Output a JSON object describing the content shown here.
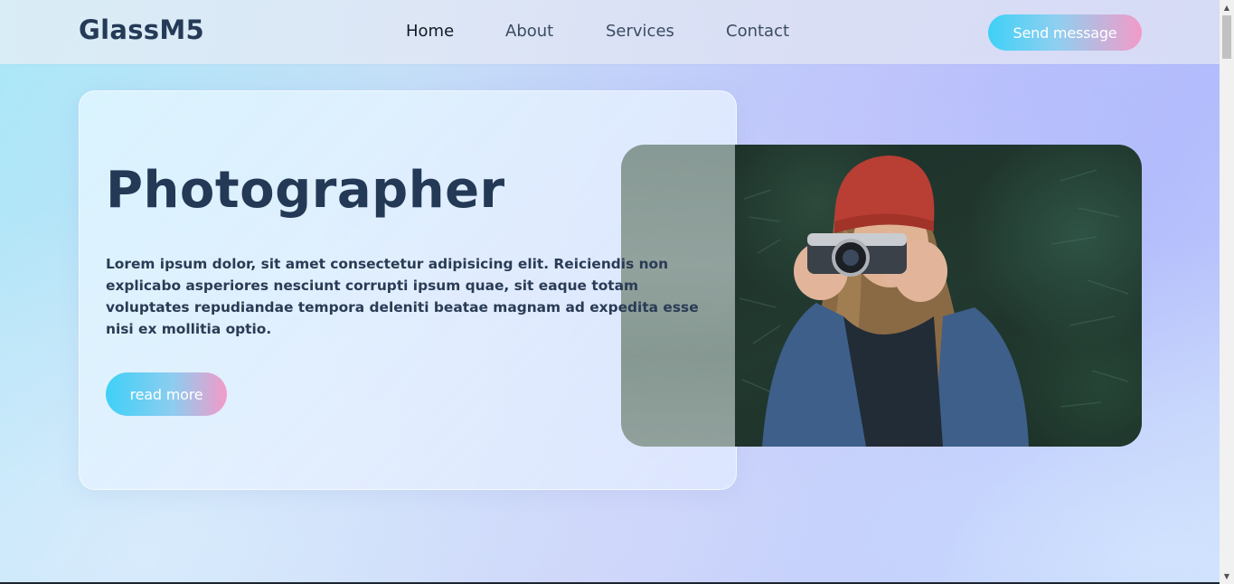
{
  "brand": {
    "logo": "GlassM5"
  },
  "nav": {
    "items": [
      {
        "label": "Home"
      },
      {
        "label": "About"
      },
      {
        "label": "Services"
      },
      {
        "label": "Contact"
      }
    ],
    "cta_label": "Send message"
  },
  "hero": {
    "title": "Photographer",
    "description": "Lorem ipsum dolor, sit amet consectetur adipisicing elit. Reiciendis non explicabo asperiores nesciunt corrupti ipsum quae, sit eaque totam voluptates repudiandae tempora deleniti beatae magnam ad expedita esse nisi ex mollitia optio.",
    "button_label": "read more",
    "image_alt": "woman-with-camera-photo"
  },
  "colors": {
    "accent_start": "#3fd0f7",
    "accent_end": "#f39ac8",
    "text_dark": "#233955"
  }
}
